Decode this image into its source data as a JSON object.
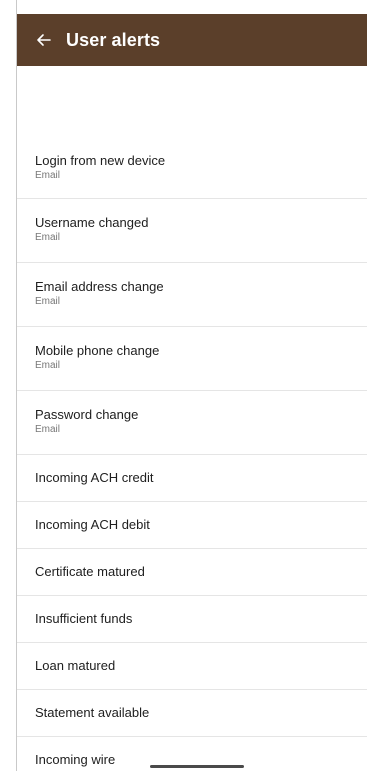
{
  "app_bar": {
    "title": "User alerts",
    "back_icon": "arrow-left-icon",
    "background_color": "#5b3f2a"
  },
  "alerts": [
    {
      "title": "Login from new device",
      "subtitle": "Email"
    },
    {
      "title": "Username changed",
      "subtitle": "Email"
    },
    {
      "title": "Email address change",
      "subtitle": "Email"
    },
    {
      "title": "Mobile phone change",
      "subtitle": "Email"
    },
    {
      "title": "Password change",
      "subtitle": "Email"
    },
    {
      "title": "Incoming ACH credit"
    },
    {
      "title": "Incoming ACH debit"
    },
    {
      "title": "Certificate matured"
    },
    {
      "title": "Insufficient funds"
    },
    {
      "title": "Loan matured"
    },
    {
      "title": "Statement available"
    },
    {
      "title": "Incoming wire"
    }
  ]
}
